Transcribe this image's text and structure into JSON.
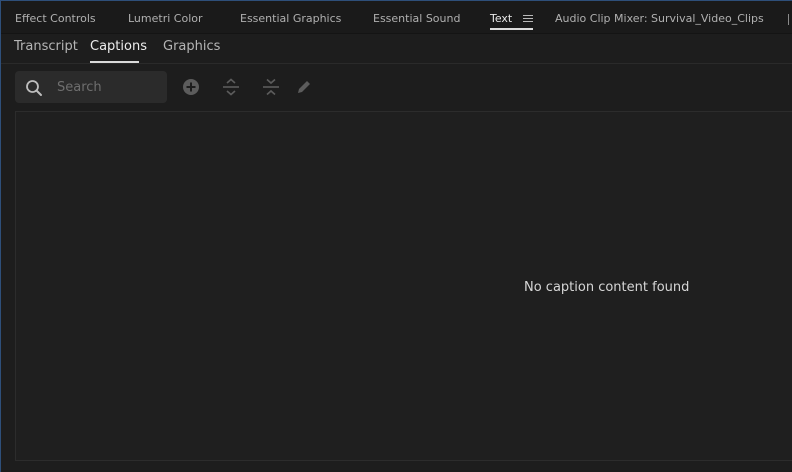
{
  "panel_tabs": [
    {
      "label": "Effect Controls"
    },
    {
      "label": "Lumetri Color"
    },
    {
      "label": "Essential Graphics"
    },
    {
      "label": "Essential Sound"
    },
    {
      "label": "Text"
    },
    {
      "label": "Audio Clip Mixer: Survival_Video_Clips"
    }
  ],
  "active_panel_tab": "Text",
  "sub_tabs": [
    {
      "label": "Transcript"
    },
    {
      "label": "Captions"
    },
    {
      "label": "Graphics"
    }
  ],
  "active_sub_tab": "Captions",
  "search": {
    "placeholder": "Search",
    "value": ""
  },
  "toolbar": {
    "icons": [
      "add-icon",
      "expand-icon",
      "collapse-icon",
      "pencil-icon"
    ]
  },
  "content": {
    "empty_message": "No caption content found"
  },
  "colors": {
    "background": "#1d1d1d",
    "focus_border": "#2e4f7a",
    "active_underline": "#dadada"
  }
}
